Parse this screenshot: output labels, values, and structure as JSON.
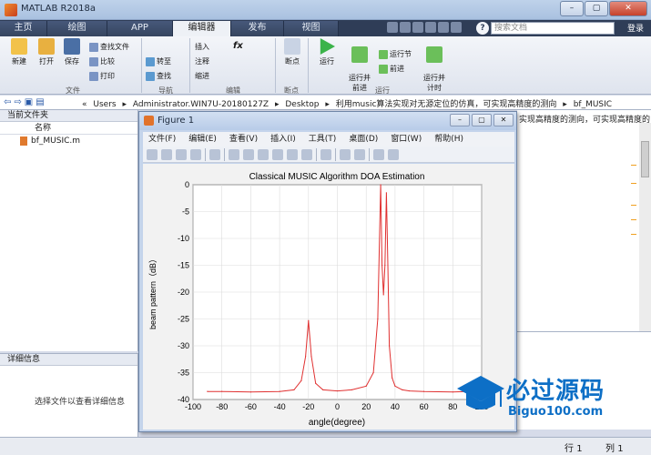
{
  "window": {
    "title": "MATLAB R2018a",
    "min": "–",
    "max": "▢",
    "close": "✕"
  },
  "tabs": [
    "主页",
    "绘图",
    "APP",
    "编辑器",
    "发布",
    "视图"
  ],
  "search": {
    "placeholder": "搜索文档"
  },
  "login": "登录",
  "ribbon": {
    "file": {
      "new": "新建",
      "open": "打开",
      "save": "保存",
      "find_files": "查找文件",
      "compare": "比较",
      "print": "打印",
      "group": "文件"
    },
    "nav": {
      "goto": "转至",
      "find": "查找",
      "group": "导航"
    },
    "edit": {
      "insert": "插入",
      "comment": "注释",
      "indent": "缩进",
      "fx": "fx",
      "group": "编辑"
    },
    "breakpoints": {
      "label": "断点",
      "group": "断点"
    },
    "run": {
      "run": "运行",
      "run_advance": "运行并\n前进",
      "run_section": "运行节",
      "advance": "前进",
      "run_time": "运行并\n计时",
      "group": "运行"
    }
  },
  "address": {
    "crumbs": [
      "«",
      "Users",
      "▸",
      "Administrator.WIN7U-20180127Z",
      "▸",
      "Desktop",
      "▸",
      "利用music算法实现对无源定位的仿真，可实现高精度的测向",
      "▸",
      "bf_MUSIC"
    ]
  },
  "left": {
    "title": "当前文件夹",
    "col_name": "名称",
    "files": [
      "bf_MUSIC.m"
    ],
    "detail_title": "详细信息",
    "detail_msg": "选择文件以查看详细信息"
  },
  "right": {
    "text": "实现高精度的测向，可实现高精度的"
  },
  "status": {
    "row_label": "行",
    "row": "1",
    "col_label": "列",
    "col": "1"
  },
  "figure": {
    "title": "Figure 1",
    "menu": [
      "文件(F)",
      "编辑(E)",
      "查看(V)",
      "插入(I)",
      "工具(T)",
      "桌面(D)",
      "窗口(W)",
      "帮助(H)"
    ]
  },
  "chart_data": {
    "type": "line",
    "title": "Classical MUSIC Algorithm DOA Estimation",
    "xlabel": "angle(degree)",
    "ylabel": "beam pattern（dB）",
    "xlim": [
      -100,
      100
    ],
    "ylim": [
      -40,
      0
    ],
    "xticks": [
      -100,
      -80,
      -60,
      -40,
      -20,
      0,
      20,
      40,
      60,
      80,
      100
    ],
    "yticks": [
      0,
      -5,
      -10,
      -15,
      -20,
      -25,
      -30,
      -35,
      -40
    ],
    "grid": true,
    "color": "#e03030",
    "x": [
      -90,
      -80,
      -60,
      -40,
      -30,
      -25,
      -22,
      -20,
      -18,
      -15,
      -10,
      0,
      10,
      20,
      25,
      28,
      30,
      31,
      32,
      33,
      34,
      35,
      36,
      38,
      40,
      45,
      50,
      60,
      80,
      90
    ],
    "y": [
      -38.5,
      -38.5,
      -38.6,
      -38.5,
      -38.2,
      -36.5,
      -32,
      -25.3,
      -32,
      -37,
      -38.2,
      -38.4,
      -38.2,
      -37.5,
      -35,
      -25,
      0,
      -15,
      -20.5,
      -15,
      -1.5,
      -15,
      -30,
      -36,
      -37.5,
      -38.2,
      -38.4,
      -38.5,
      -38.6,
      -38.5
    ]
  },
  "watermark": {
    "cn": "必过源码",
    "en": "Biguo100.com"
  }
}
